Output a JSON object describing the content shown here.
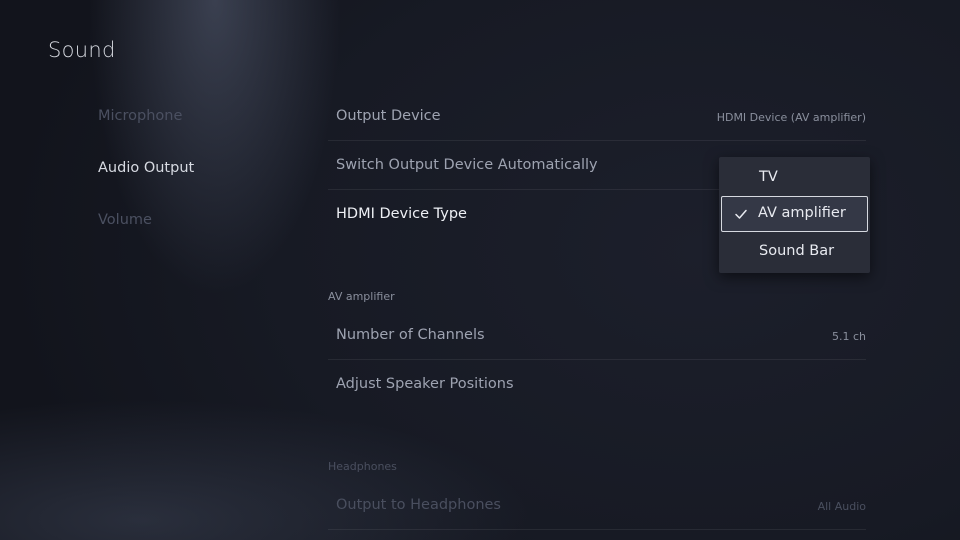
{
  "page": {
    "title": "Sound"
  },
  "nav": {
    "items": [
      {
        "label": "Microphone"
      },
      {
        "label": "Audio Output"
      },
      {
        "label": "Volume"
      }
    ]
  },
  "settings": {
    "output_device": {
      "label": "Output Device",
      "value": "HDMI Device (AV amplifier)"
    },
    "switch_auto": {
      "label": "Switch Output Device Automatically"
    },
    "hdmi_type": {
      "label": "HDMI Device Type"
    },
    "av_section": {
      "header": "AV amplifier"
    },
    "channels": {
      "label": "Number of Channels",
      "value": "5.1 ch"
    },
    "speaker_positions": {
      "label": "Adjust Speaker Positions"
    },
    "headphones_section": {
      "header": "Headphones"
    },
    "output_headphones": {
      "label": "Output to Headphones",
      "value": "All Audio"
    }
  },
  "dropdown": {
    "options": [
      {
        "label": "TV"
      },
      {
        "label": "AV amplifier"
      },
      {
        "label": "Sound Bar"
      }
    ],
    "selected_index": 1
  },
  "icons": {
    "check": "check-icon"
  },
  "colors": {
    "accent": "#d6d9e0",
    "background": "#171a24"
  }
}
